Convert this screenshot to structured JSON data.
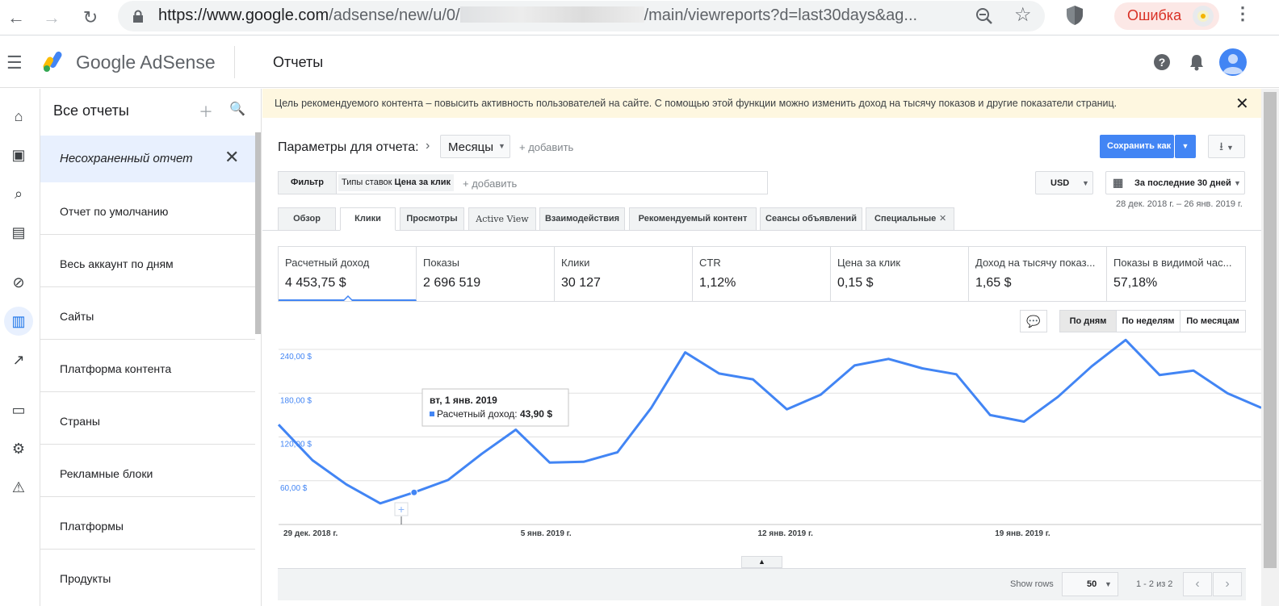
{
  "browser": {
    "url_host": "https://www.google.com",
    "url_path_start": "/adsense/new/u/0/",
    "url_path_end": "/main/viewreports?d=last30days&ag...",
    "profile_status": "Ошибка"
  },
  "header": {
    "brand": "Google AdSense",
    "page_title": "Отчеты"
  },
  "sidebar": {
    "title": "Все отчеты",
    "unsaved": "Несохраненный отчет",
    "items": [
      {
        "label": "Отчет по умолчанию"
      },
      {
        "label": "Весь аккаунт по дням"
      },
      {
        "label": "Сайты"
      },
      {
        "label": "Платформа контента"
      },
      {
        "label": "Страны"
      },
      {
        "label": "Рекламные блоки"
      },
      {
        "label": "Платформы"
      },
      {
        "label": "Продукты"
      }
    ]
  },
  "banner": {
    "text": "Цель рекомендуемого контента – повысить активность пользователей на сайте. С помощью этой функции можно изменить доход на тысячу показов и другие показатели страниц."
  },
  "params": {
    "label": "Параметры для отчета:",
    "dimension": "Месяцы",
    "add": "+ добавить"
  },
  "toolbar": {
    "save_label": "Сохранить как",
    "currency": "USD",
    "date_label": "За последние 30 дней",
    "date_range": "28 дек. 2018 г. – 26 янв. 2019 г."
  },
  "filter": {
    "label": "Фильтр",
    "chip_prefix": "Типы ставок",
    "chip_value": "Цена за клик",
    "add": "+ добавить"
  },
  "tabs": [
    {
      "label": "Обзор"
    },
    {
      "label": "Клики"
    },
    {
      "label": "Просмотры"
    },
    {
      "label": "Active View"
    },
    {
      "label": "Взаимодействия"
    },
    {
      "label": "Рекомендуемый контент"
    },
    {
      "label": "Сеансы объявлений"
    },
    {
      "label": "Специальные"
    }
  ],
  "metrics": [
    {
      "label": "Расчетный доход",
      "value": "4 453,75 $"
    },
    {
      "label": "Показы",
      "value": "2 696 519"
    },
    {
      "label": "Клики",
      "value": "30 127"
    },
    {
      "label": "CTR",
      "value": "1,12%"
    },
    {
      "label": "Цена за клик",
      "value": "0,15 $"
    },
    {
      "label": "Доход на тысячу показ...",
      "value": "1,65 $"
    },
    {
      "label": "Показы в видимой час...",
      "value": "57,18%"
    }
  ],
  "granularity": {
    "day": "По дням",
    "week": "По неделям",
    "month": "По месяцам"
  },
  "tooltip": {
    "date": "вт, 1 янв. 2019",
    "series": "Расчетный доход:",
    "value": "43,90 $"
  },
  "pagination": {
    "show_rows": "Show rows",
    "rows": "50",
    "info": "1 - 2 из 2"
  },
  "colors": {
    "accent": "#4285f4",
    "banner_bg": "#fef7e0",
    "error": "#d93025"
  },
  "chart_data": {
    "type": "line",
    "series": [
      {
        "name": "Расчетный доход",
        "values": [
          137,
          88,
          55,
          29,
          44,
          61,
          97,
          130,
          85,
          86,
          99,
          160,
          236,
          207,
          199,
          158,
          178,
          218,
          227,
          214,
          206,
          150,
          141,
          175,
          217,
          253,
          205,
          211,
          180,
          160
        ]
      }
    ],
    "x_tick_labels": [
      "29 дек. 2018 г.",
      "5 янв. 2019 г.",
      "12 янв. 2019 г.",
      "19 янв. 2019 г."
    ],
    "y_tick_labels": [
      "60,00 $",
      "120,00 $",
      "180,00 $",
      "240,00 $"
    ],
    "ylim": [
      0,
      250
    ],
    "highlight_index": 4,
    "grid": true
  }
}
